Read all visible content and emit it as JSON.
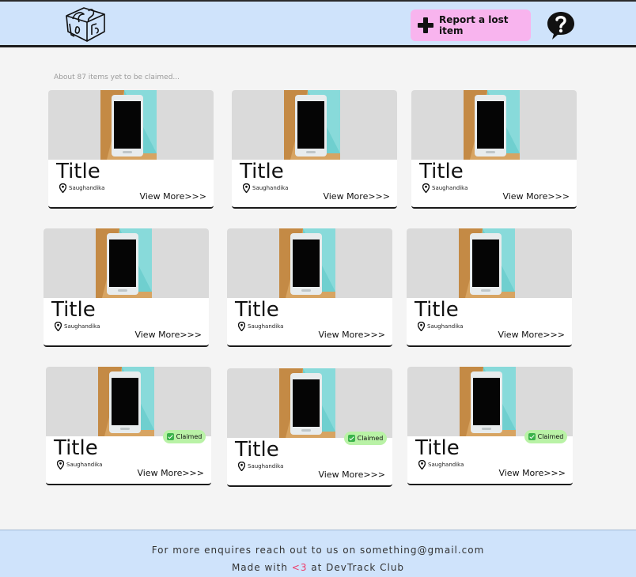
{
  "header": {
    "logo_icon": "lost-and-found-box-logo",
    "report_button": {
      "label": "Report a lost item",
      "icon": "plus-icon",
      "color": "#f8b4ee"
    },
    "help_icon": "question-bubble-icon",
    "background": "#cfe3fb"
  },
  "main": {
    "items_count_note": "About 87 items yet to be claimed...",
    "view_more_label": "View More>>>",
    "items": [
      {
        "title": "Title",
        "location": "Saughandika",
        "claimed": false
      },
      {
        "title": "Title",
        "location": "Saughandika",
        "claimed": false
      },
      {
        "title": "Title",
        "location": "Saughandika",
        "claimed": false
      },
      {
        "title": "Title",
        "location": "Saughandika",
        "claimed": false
      },
      {
        "title": "Title",
        "location": "Saughandika",
        "claimed": false
      },
      {
        "title": "Title",
        "location": "Saughandika",
        "claimed": false
      },
      {
        "title": "Title",
        "location": "Saughandika",
        "claimed": true,
        "badge": "Claimed"
      },
      {
        "title": "Title",
        "location": "Saughandika",
        "claimed": true,
        "badge": "Claimed"
      },
      {
        "title": "Title",
        "location": "Saughandika",
        "claimed": true,
        "badge": "Claimed"
      }
    ]
  },
  "footer": {
    "enquiry_text": "For more enquires reach out to us on something@gmail.com",
    "made_with_prefix": "Made with",
    "heart": "<3",
    "made_with_suffix": "at DevTrack Club",
    "heart_color": "#ee3b6a"
  }
}
